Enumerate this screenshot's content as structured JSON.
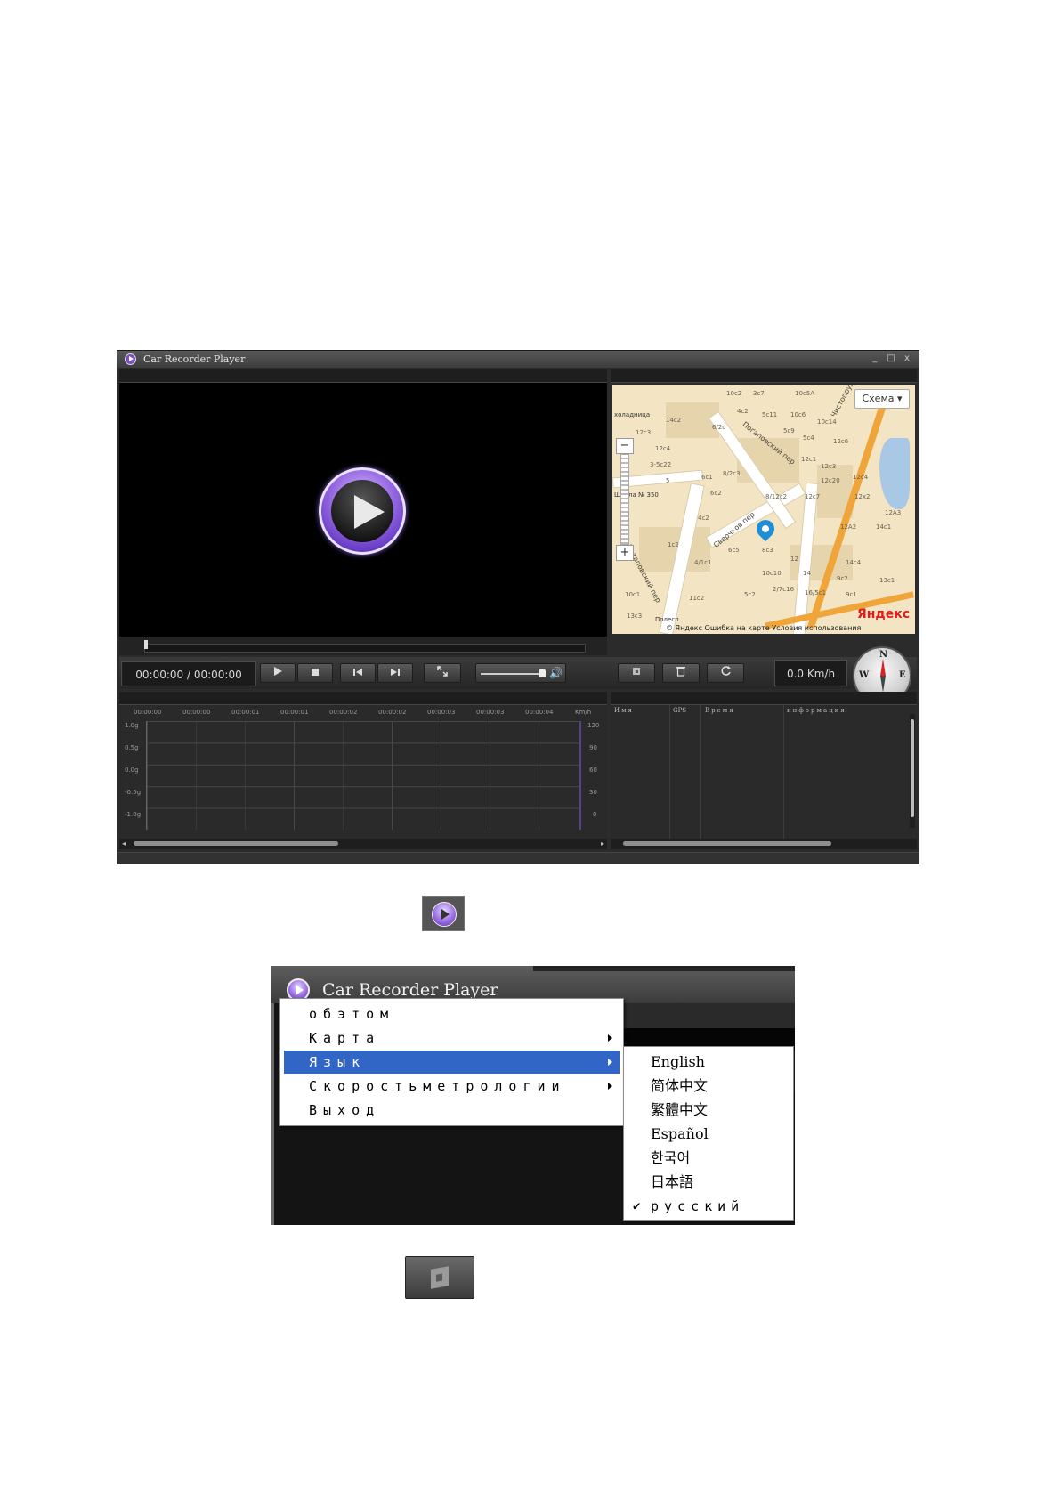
{
  "app": {
    "title": "Car Recorder Player",
    "win_min": "_",
    "win_max": "□",
    "win_close": "x"
  },
  "player": {
    "time": "00:00:00 / 00:00:00",
    "speed": "0.0 Km/h",
    "compass": {
      "n": "N",
      "w": "W",
      "e": "E"
    },
    "seek_position": 0
  },
  "map": {
    "schema_label": "Схема ▾",
    "zoom_in": "+",
    "zoom_out": "−",
    "streets": [
      "Поґаповский пер",
      "Сверчков пер",
      "Потаповский пер",
      "Чистопрудный бул"
    ],
    "labels": [
      "10с2",
      "3с7",
      "10с5А",
      "4с2",
      "5с11",
      "10с6",
      "6/2с",
      "14с2",
      "10с14",
      "12с3",
      "5с9",
      "5с4",
      "12с6",
      "12с4",
      "3-5с22",
      "6с1",
      "8/2с3",
      "12с3",
      "12с1",
      "12с20",
      "5",
      "6с2",
      "8/12с2",
      "12с7",
      "12х2",
      "12с4",
      "12А3",
      "12А2",
      "14с1",
      "4с2",
      "6с5",
      "8с3",
      "12",
      "14с4",
      "1с2",
      "4/1с1",
      "10с10",
      "14",
      "9с2",
      "13с1",
      "5с2",
      "2/7с16",
      "16/5с1",
      "9с1",
      "11с2",
      "10с1",
      "13с3",
      "Школа № 350",
      "холадница",
      "Полесп"
    ],
    "footer": "© Яндекс  Ошибка на карте  Условия использования",
    "brand": "Яндекс"
  },
  "graph": {
    "time_labels": [
      "00:00:00",
      "00:00:00",
      "00:00:01",
      "00:00:01",
      "00:00:02",
      "00:00:02",
      "00:00:03",
      "00:00:03",
      "00:00:04"
    ],
    "g_labels": [
      "1.0g",
      "0.5g",
      "0.0g",
      "-0.5g",
      "-1.0g"
    ],
    "speed_unit": "Km/h",
    "speed_labels": [
      "120",
      "90",
      "60",
      "30",
      "0"
    ]
  },
  "list": {
    "columns": [
      "Имя",
      "GPS",
      "Время",
      "информация"
    ]
  },
  "menu_shot": {
    "title": "Car Recorder Player",
    "items": [
      {
        "label": "обэтом",
        "submenu": false
      },
      {
        "label": "Карта",
        "submenu": true
      },
      {
        "label": "Язык",
        "submenu": true
      },
      {
        "label": "Скоростьметрологии",
        "submenu": true
      },
      {
        "label": "Выход",
        "submenu": false
      }
    ],
    "languages": [
      "English",
      "简体中文",
      "繁體中文",
      "Español",
      "한국어",
      "日本語",
      "русский"
    ],
    "checked_language": "русский",
    "check_mark": "✔"
  },
  "colors": {
    "menu_highlight": "#3166c6",
    "window_bg": "#2b2b2b",
    "logo_purple": "#7a4fc6"
  },
  "icons": [
    "play-icon",
    "stop-icon",
    "prev-icon",
    "next-icon",
    "fullscreen-icon",
    "speaker-icon",
    "snapshot-icon",
    "delete-icon",
    "refresh-icon",
    "compass-icon"
  ]
}
